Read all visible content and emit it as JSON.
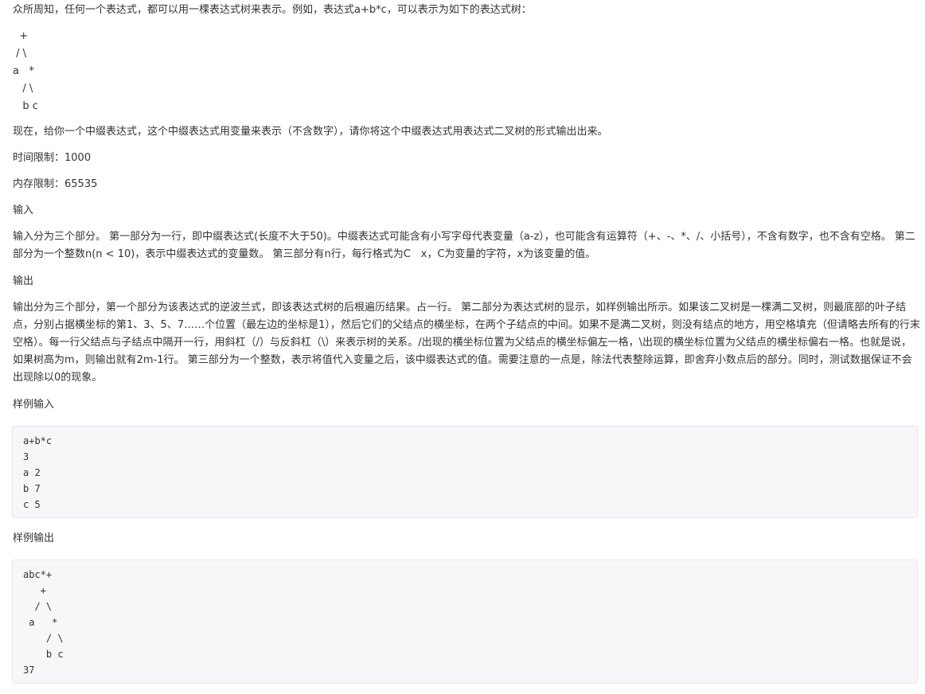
{
  "problem": {
    "intro": "众所周知，任何一个表达式，都可以用一棵表达式树来表示。例如，表达式a+b*c，可以表示为如下的表达式树：",
    "example_tree": "  +\n / \\\na   *\n   / \\\n   b c",
    "description": "现在，给你一个中缀表达式，这个中缀表达式用变量来表示（不含数字），请你将这个中缀表达式用表达式二叉树的形式输出出来。",
    "time_limit": "时间限制：1000",
    "memory_limit": "内存限制：65535",
    "input_heading": "输入",
    "input_text": "输入分为三个部分。 第一部分为一行，即中缀表达式(长度不大于50)。中缀表达式可能含有小写字母代表变量（a-z），也可能含有运算符（+、-、*、/、小括号），不含有数字，也不含有空格。 第二部分为一个整数n(n < 10)，表示中缀表达式的变量数。 第三部分有n行，每行格式为C　x，C为变量的字符，x为该变量的值。",
    "output_heading": "输出",
    "output_text": "输出分为三个部分，第一个部分为该表达式的逆波兰式，即该表达式树的后根遍历结果。占一行。 第二部分为表达式树的显示，如样例输出所示。如果该二叉树是一棵满二叉树，则最底部的叶子结点，分别占据横坐标的第1、3、5、7……个位置（最左边的坐标是1），然后它们的父结点的横坐标，在两个子结点的中间。如果不是满二叉树，则没有结点的地方，用空格填充（但请略去所有的行末空格）。每一行父结点与子结点中隔开一行，用斜杠（/）与反斜杠（\\）来表示树的关系。/出现的横坐标位置为父结点的横坐标偏左一格，\\出现的横坐标位置为父结点的横坐标偏右一格。也就是说，如果树高为m，则输出就有2m-1行。 第三部分为一个整数，表示将值代入变量之后，该中缀表达式的值。需要注意的一点是，除法代表整除运算，即舍弃小数点后的部分。同时，测试数据保证不会出现除以0的现象。",
    "sample_input_heading": "样例输入",
    "sample_input": "a+b*c\n3\na 2\nb 7\nc 5",
    "sample_output_heading": "样例输出",
    "sample_output": "abc*+\n   +\n  / \\\n a   *\n    / \\\n    b c\n37"
  }
}
